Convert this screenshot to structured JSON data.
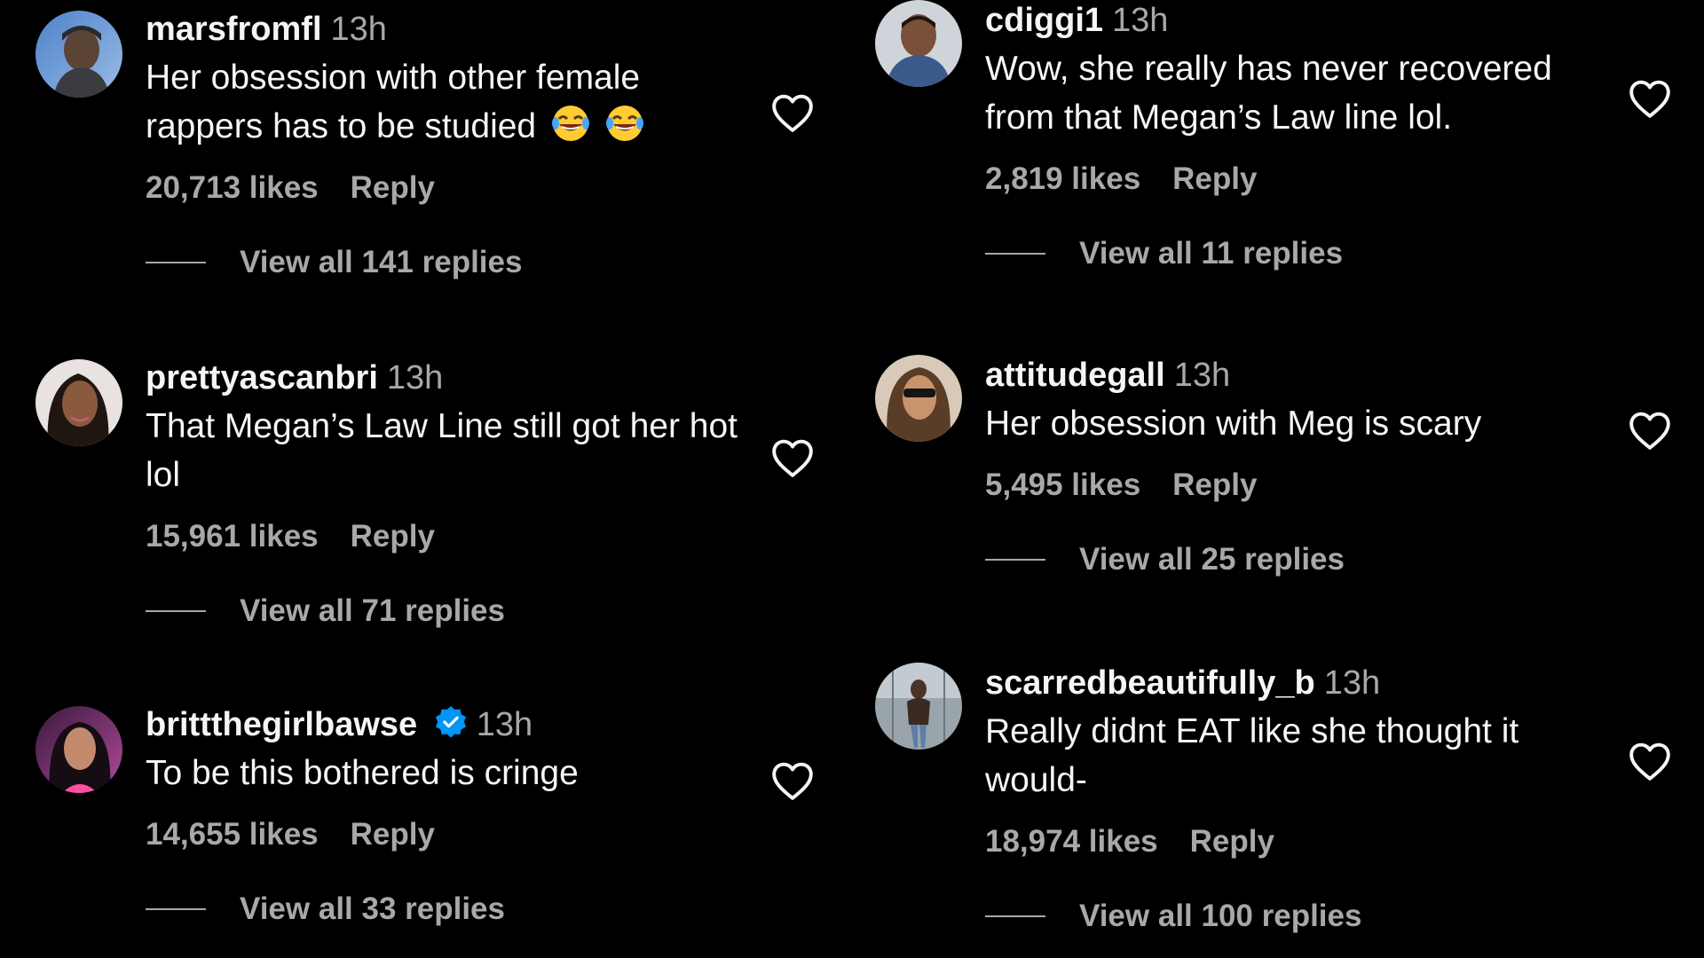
{
  "colors": {
    "background": "#000000",
    "primary_text": "#f5f5f5",
    "secondary_text": "#a8a8a8",
    "verified_blue": "#0095f6"
  },
  "icons": {
    "like": "heart-outline-icon",
    "verified": "verified-badge-icon",
    "emoji": "face-with-tears-of-joy-emoji"
  },
  "left": [
    {
      "username": "marsfromfl",
      "time": "13h",
      "text": "Her obsession with other female rappers has to be studied",
      "emoji_count": 2,
      "likes": "20,713 likes",
      "reply": "Reply",
      "view_replies": "View all 141 replies",
      "verified": false
    },
    {
      "username": "prettyascanbri",
      "time": "13h",
      "text": "That Megan’s Law Line still got her hot lol",
      "likes": "15,961 likes",
      "reply": "Reply",
      "view_replies": "View all 71 replies",
      "verified": false
    },
    {
      "username": "brittthegirlbawse",
      "time": "13h",
      "text": "To be this bothered is cringe",
      "likes": "14,655 likes",
      "reply": "Reply",
      "view_replies": "View all 33 replies",
      "verified": true
    }
  ],
  "right": [
    {
      "username": "cdiggi1",
      "time": "13h",
      "text": "Wow, she really has never recovered from that Megan’s Law line lol.",
      "likes": "2,819 likes",
      "reply": "Reply",
      "view_replies": "View all 11 replies",
      "verified": false
    },
    {
      "username": "attitudegall",
      "time": "13h",
      "text": "Her obsession with Meg is scary",
      "likes": "5,495 likes",
      "reply": "Reply",
      "view_replies": "View all 25 replies",
      "verified": false
    },
    {
      "username": "scarredbeautifully_b",
      "time": "13h",
      "text": "Really didnt EAT like she thought it would-",
      "likes": "18,974 likes",
      "reply": "Reply",
      "view_replies": "View all 100 replies",
      "verified": false
    }
  ]
}
